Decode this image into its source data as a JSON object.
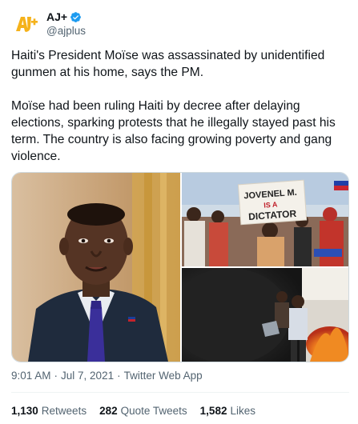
{
  "account": {
    "display_name": "AJ+",
    "handle": "@ajplus",
    "avatar_logo_text": "AJ+"
  },
  "tweet": {
    "paragraph_1": "Haiti's President Moïse was assassinated by unidentified gunmen at his home, says the PM.",
    "paragraph_2": "Moïse had been ruling Haiti by decree after delaying elections, sparking protests that he illegally stayed past his term. The country is also facing growing poverty and gang violence."
  },
  "media": {
    "protest_sign_line_1": "JOVENEL M.",
    "protest_sign_line_2": "IS A",
    "protest_sign_line_3": "DICTATOR"
  },
  "meta": {
    "time": "9:01 AM",
    "dot_1": "·",
    "date": "Jul 7, 2021",
    "dot_2": "·",
    "source": "Twitter Web App"
  },
  "stats": {
    "retweets_count": "1,130",
    "retweets_label": "Retweets",
    "quotes_count": "282",
    "quotes_label": "Quote Tweets",
    "likes_count": "1,582",
    "likes_label": "Likes"
  },
  "colors": {
    "text": "#0f1419",
    "secondary": "#536471",
    "verified": "#1d9bf0",
    "brand_yellow": "#f5b21b"
  },
  "icons": {
    "verified": "verified-badge-icon"
  }
}
